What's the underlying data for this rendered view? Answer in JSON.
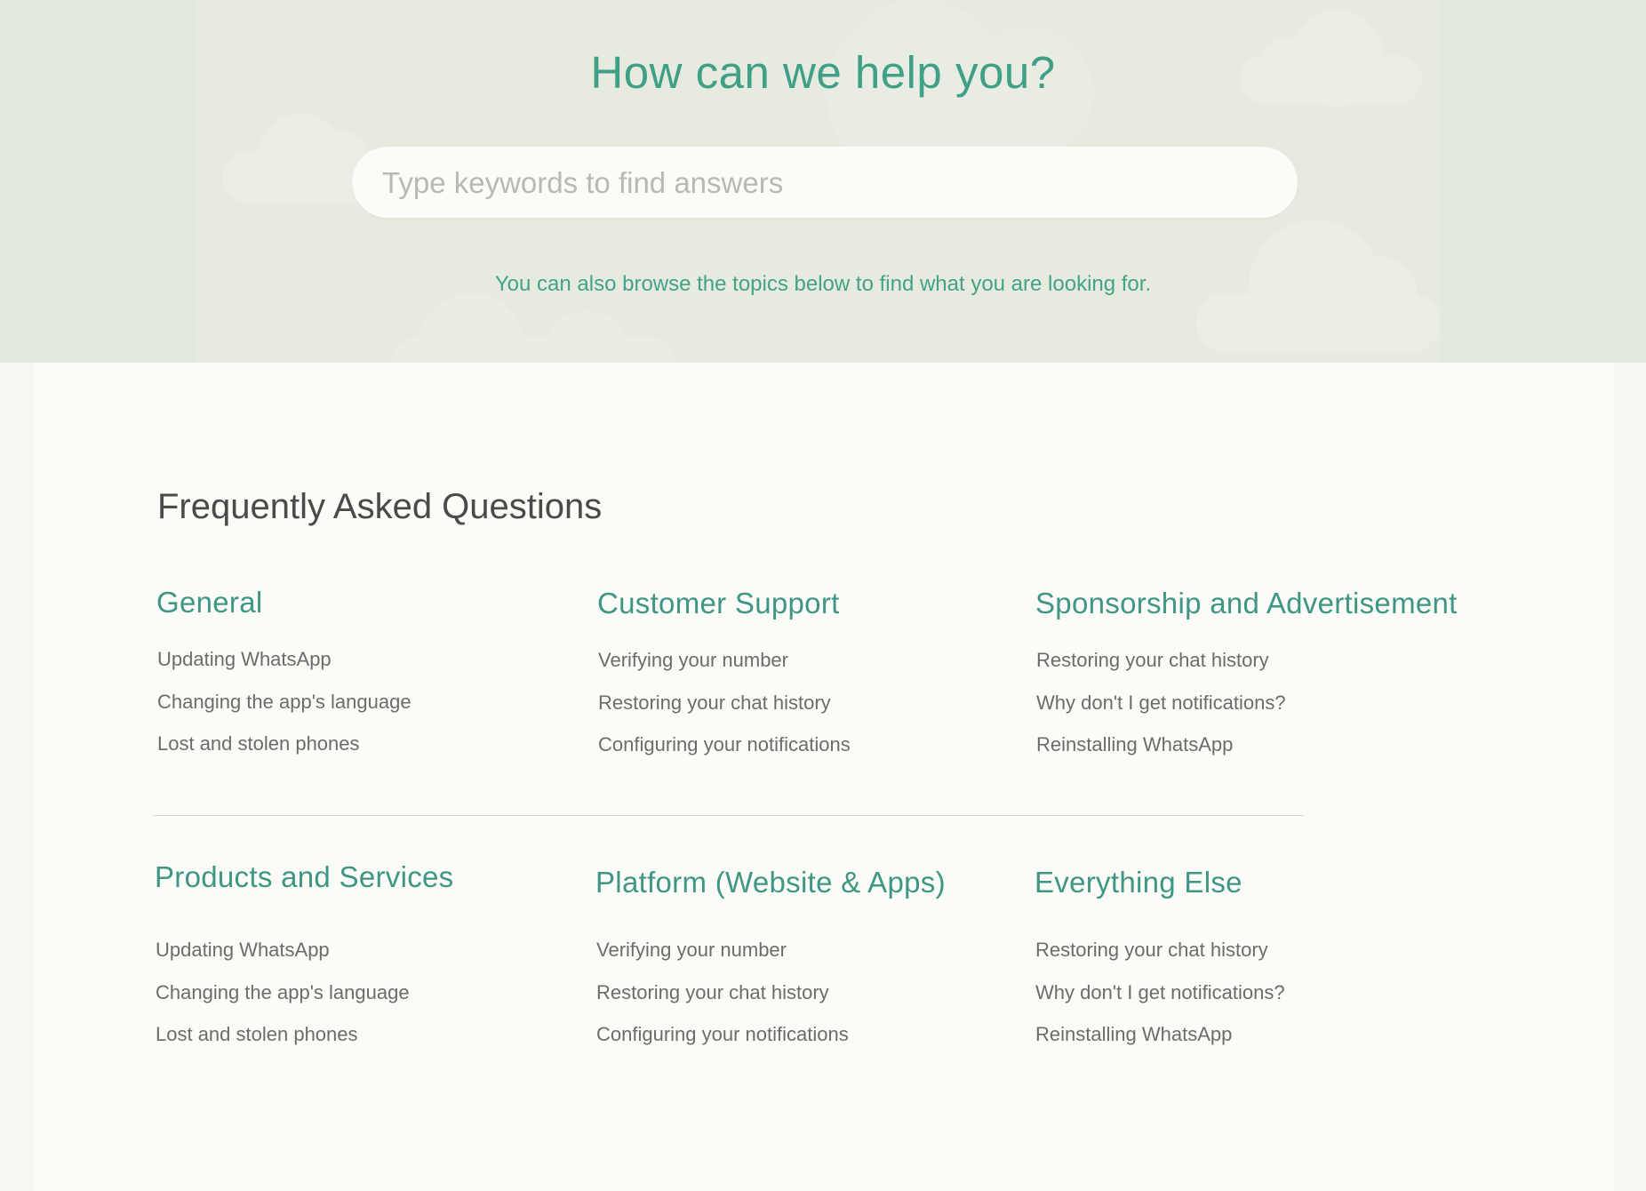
{
  "hero": {
    "title": "How can we help you?",
    "search_placeholder": "Type keywords to find answers",
    "search_value": "",
    "browse_note": "You can also browse the topics below to find what you are looking for."
  },
  "faq": {
    "title": "Frequently Asked Questions",
    "categories": [
      {
        "title": "General",
        "items": [
          "Updating WhatsApp",
          "Changing the app's language",
          "Lost and stolen phones"
        ]
      },
      {
        "title": "Customer Support",
        "items": [
          "Verifying your number",
          "Restoring your chat history",
          "Configuring your notifications"
        ]
      },
      {
        "title": "Sponsorship and Advertisement",
        "items": [
          "Restoring your chat history",
          "Why don't I get notifications?",
          "Reinstalling WhatsApp"
        ]
      },
      {
        "title": "Products and Services",
        "items": [
          "Updating WhatsApp",
          "Changing the app's language",
          "Lost and stolen phones"
        ]
      },
      {
        "title": "Platform (Website & Apps)",
        "items": [
          "Verifying your number",
          "Restoring your chat history",
          "Configuring your notifications"
        ]
      },
      {
        "title": "Everything Else",
        "items": [
          "Restoring your chat history",
          "Why don't I get notifications?",
          "Reinstalling WhatsApp"
        ]
      }
    ]
  },
  "colors": {
    "accent": "#3f9f87",
    "hero_bg": "#e3e9dd",
    "content_bg": "#fbfbf8",
    "link_text": "#6c6c6c"
  }
}
